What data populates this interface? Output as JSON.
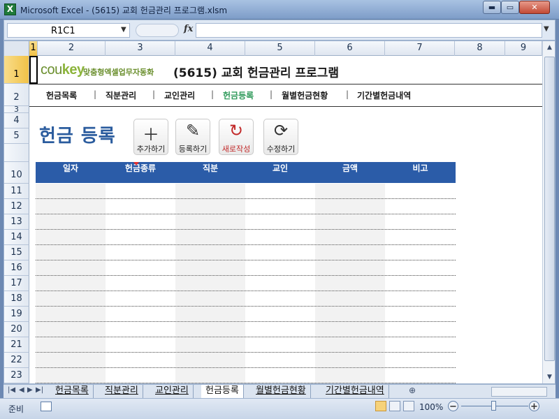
{
  "window": {
    "title": "Microsoft Excel - (5615) 교회 헌금관리 프로그램.xlsm",
    "app_icon": "X",
    "min_glyph": "▬",
    "max_glyph": "▭",
    "close_glyph": "✕"
  },
  "formula_bar": {
    "name_box": "R1C1",
    "fx": "fx",
    "formula": ""
  },
  "columns": [
    "1",
    "2",
    "3",
    "4",
    "5",
    "6",
    "7",
    "8",
    "9"
  ],
  "rows": [
    "1",
    "2",
    "3",
    "4",
    "5",
    "10",
    "11",
    "12",
    "13",
    "14",
    "15",
    "16",
    "17",
    "18",
    "19",
    "20",
    "21",
    "22",
    "23"
  ],
  "brand": {
    "logo_prefix": "cou",
    "logo_suffix": "key",
    "tagline": "맞춤형엑셀업무자동화",
    "doc_title": "(5615) 교회 헌금관리 프로그램"
  },
  "menu": [
    {
      "label": "헌금목록",
      "active": false
    },
    {
      "label": "직분관리",
      "active": false
    },
    {
      "label": "교인관리",
      "active": false
    },
    {
      "label": "헌금등록",
      "active": true
    },
    {
      "label": "월별헌금현황",
      "active": false
    },
    {
      "label": "기간별헌금내역",
      "active": false
    }
  ],
  "menu_separator": "|",
  "page_title": "헌금 등록",
  "toolbar": [
    {
      "glyph": "＋",
      "label": "추가하기"
    },
    {
      "glyph": "✎",
      "label": "등록하기"
    },
    {
      "glyph": "↻",
      "label": "새로작성"
    },
    {
      "glyph": "⟳",
      "label": "수정하기"
    }
  ],
  "table": {
    "headers": [
      "일자",
      "헌금종류",
      "직분",
      "교인",
      "금액",
      "비고"
    ],
    "row_count": 13
  },
  "sheet_tabs": [
    "헌금목록",
    "직분관리",
    "교인관리",
    "헌금등록",
    "월별헌금현황",
    "기간별헌금내역"
  ],
  "active_sheet": "헌금등록",
  "status": {
    "mode": "준비",
    "zoom": "100%",
    "zoom_level_percent": 100
  },
  "colors": {
    "table_header_bg": "#2b5ca8",
    "page_title": "#2b5c9e",
    "active_menu": "#2f9a5a",
    "brand_green": "#6b8f2e",
    "new_button_red": "#c22a2a"
  }
}
